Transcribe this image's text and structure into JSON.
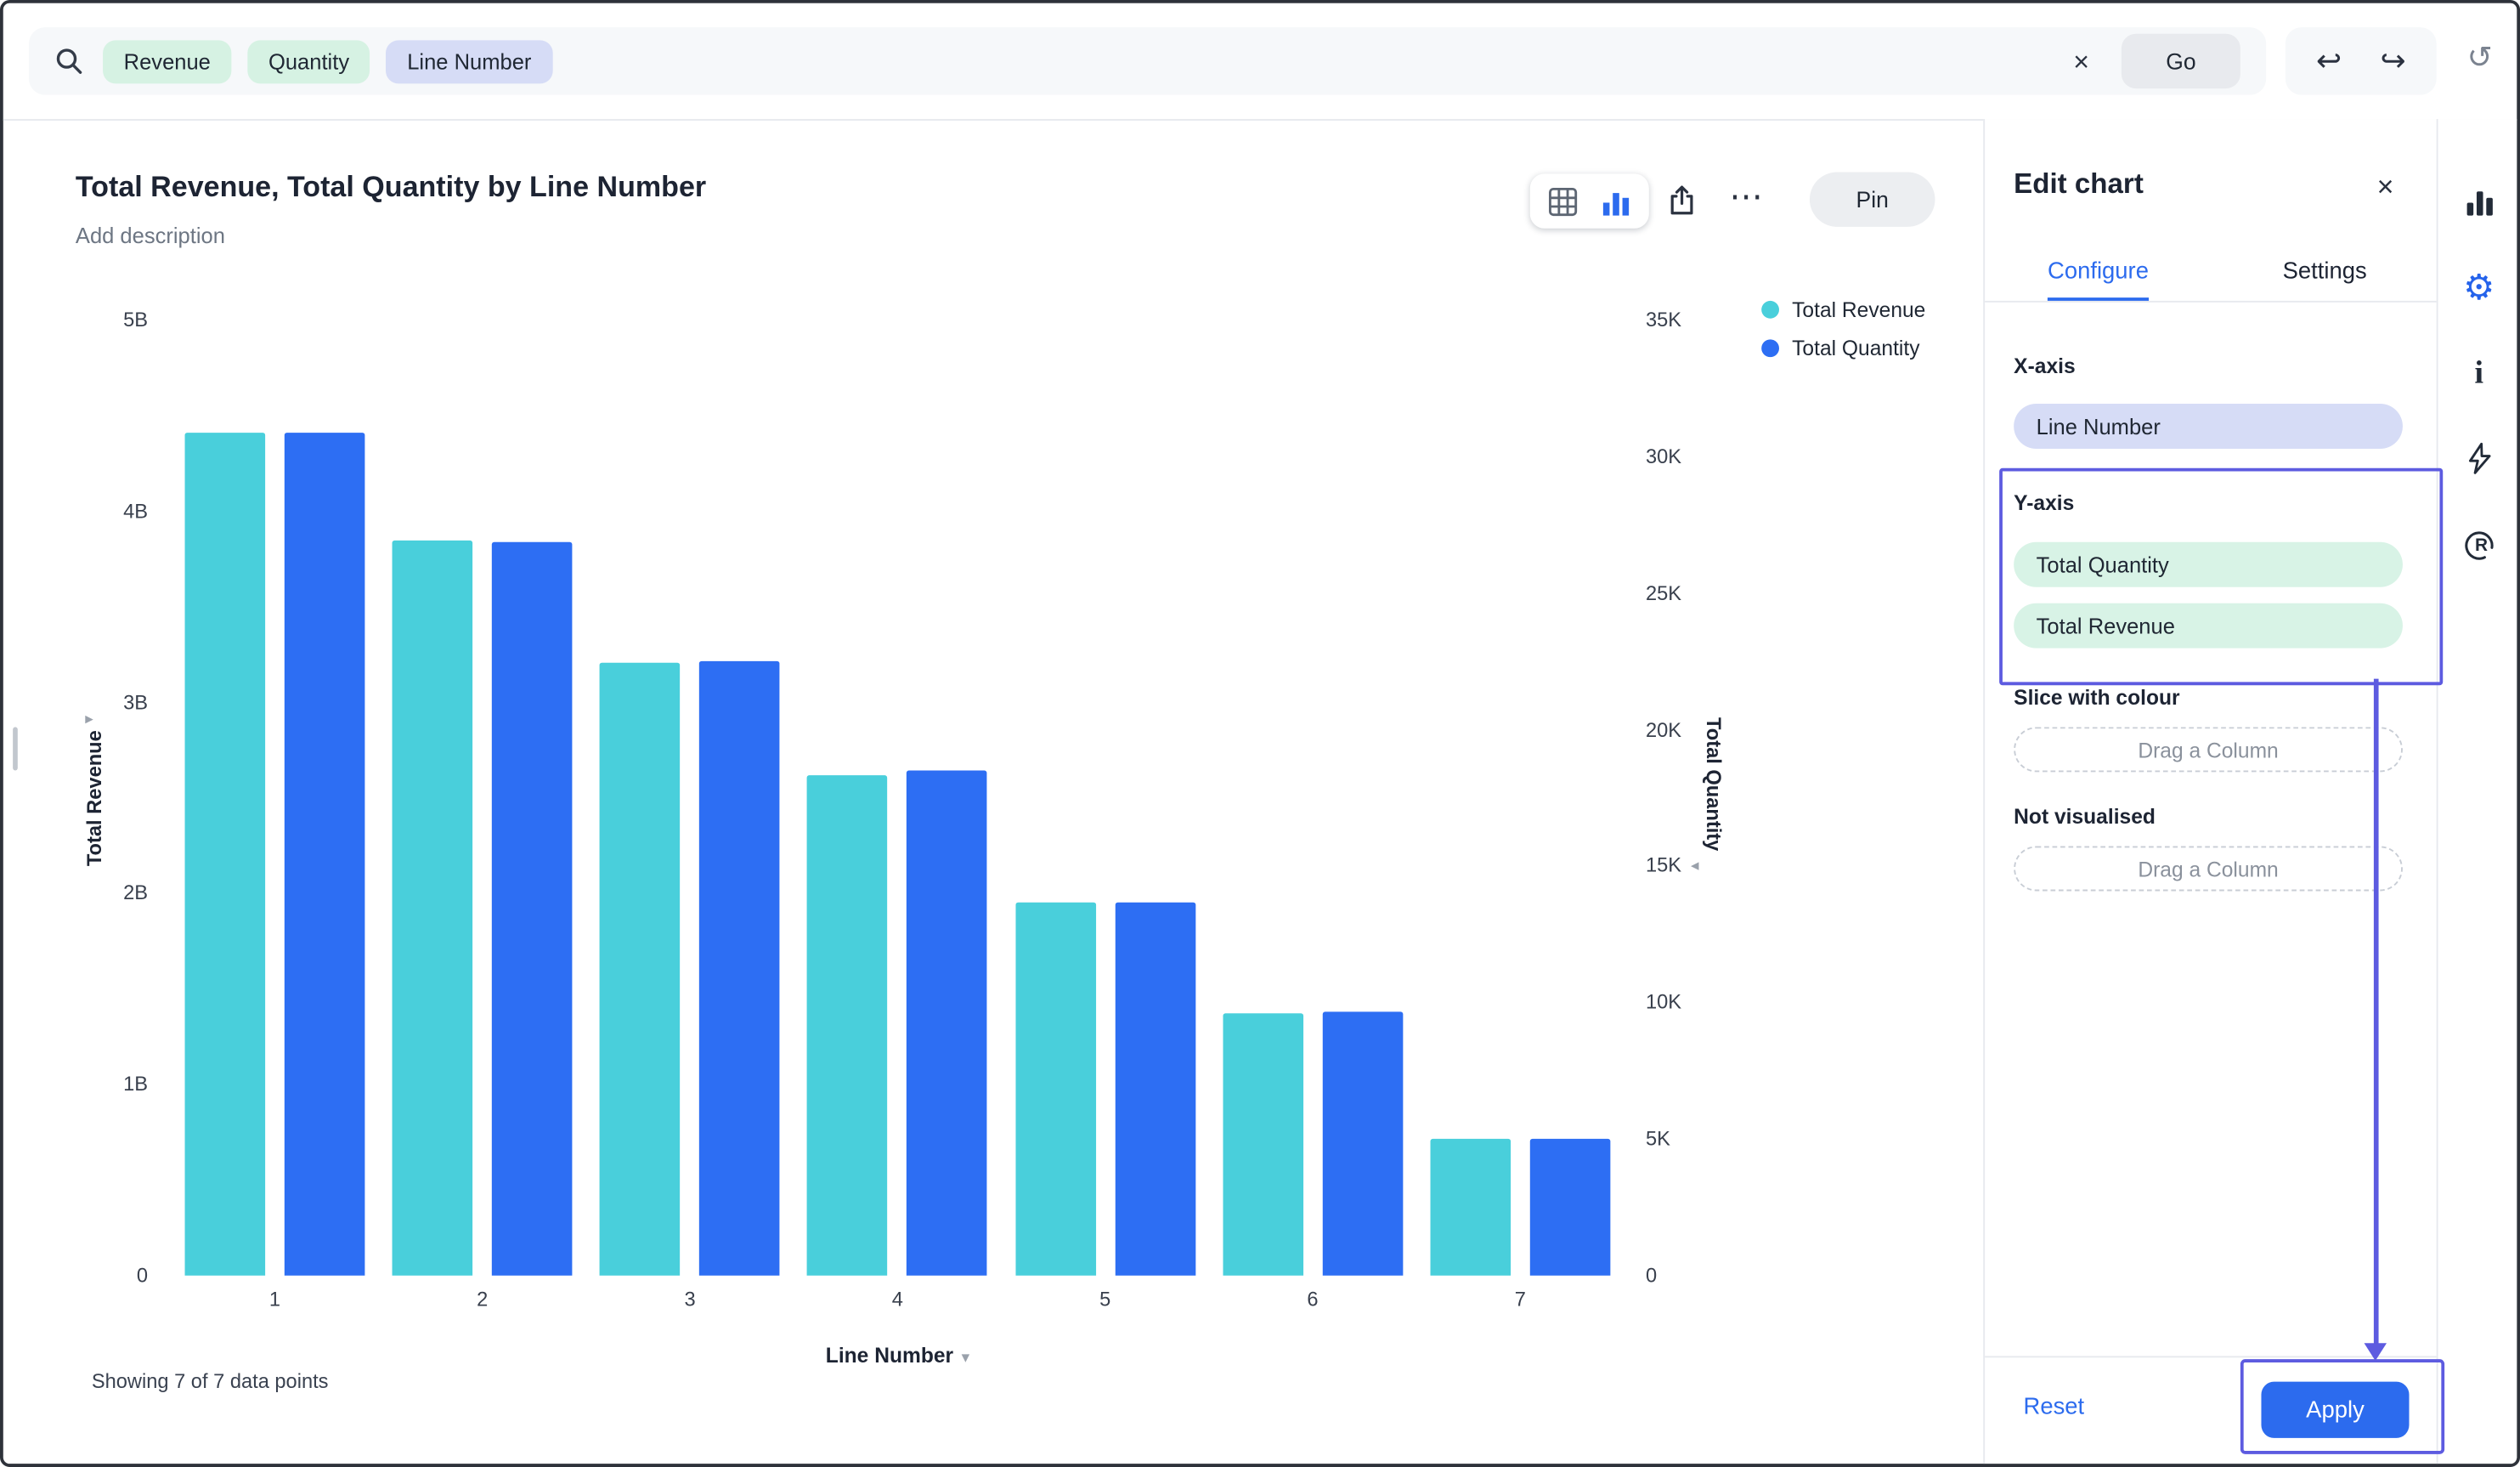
{
  "search_bar": {
    "tokens": [
      {
        "label": "Revenue",
        "color": "green"
      },
      {
        "label": "Quantity",
        "color": "green"
      },
      {
        "label": "Line Number",
        "color": "blue"
      }
    ],
    "go_label": "Go"
  },
  "icons": {
    "close": "×",
    "more": "⋯",
    "undo": "↩",
    "redo": "↪",
    "refresh": "↺",
    "gear": "⚙",
    "info": "i",
    "caret_down": "▾",
    "caret_right": "▸",
    "caret_left": "◂",
    "r_letter": "R"
  },
  "chart_header": {
    "title": "Total Revenue, Total Quantity by Line Number",
    "description_placeholder": "Add description",
    "pin_label": "Pin"
  },
  "chart_data": {
    "type": "bar",
    "title": "Total Revenue, Total Quantity by Line Number",
    "categories": [
      "1",
      "2",
      "3",
      "4",
      "5",
      "6",
      "7"
    ],
    "series": [
      {
        "name": "Total Revenue",
        "axis": "left",
        "color": "#49CFDB",
        "unit": "B",
        "values": [
          4.41,
          3.85,
          3.21,
          2.62,
          1.95,
          1.37,
          0.72
        ]
      },
      {
        "name": "Total Quantity",
        "axis": "right",
        "color": "#2D6EF3",
        "values": [
          30900,
          26900,
          22500,
          18500,
          13700,
          9650,
          5000
        ]
      }
    ],
    "left_axis": {
      "label": "Total Revenue",
      "ticks": [
        "5B",
        "4B",
        "3B",
        "2B",
        "1B",
        "0"
      ],
      "max": 5,
      "min": 0
    },
    "right_axis": {
      "label": "Total Quantity",
      "ticks": [
        "35K",
        "30K",
        "25K",
        "20K",
        "15K",
        "10K",
        "5K",
        "0"
      ],
      "max": 35000,
      "min": 0
    },
    "xlabel": "Line Number",
    "legend_position": "top-right",
    "grid": false,
    "footer": "Showing 7 of 7 data points"
  },
  "edit_panel": {
    "title": "Edit chart",
    "tabs": [
      {
        "label": "Configure",
        "active": true
      },
      {
        "label": "Settings",
        "active": false
      }
    ],
    "x_axis_label": "X-axis",
    "x_axis_value": "Line Number",
    "y_axis_label": "Y-axis",
    "y_axis_values": [
      "Total Quantity",
      "Total Revenue"
    ],
    "slice_label": "Slice with colour",
    "slice_placeholder": "Drag a Column",
    "not_visualised_label": "Not visualised",
    "not_visualised_placeholder": "Drag a Column",
    "reset_label": "Reset",
    "apply_label": "Apply"
  },
  "colors": {
    "accent_blue": "#2C6BEE",
    "bar_teal": "#49CFDB",
    "bar_blue": "#2D6EF3",
    "annotation_purple": "#5D5BE0",
    "token_green_bg": "#D6F2E3",
    "token_lavender_bg": "#D6DCF6",
    "pill_green_bg": "#D8F3E6"
  }
}
